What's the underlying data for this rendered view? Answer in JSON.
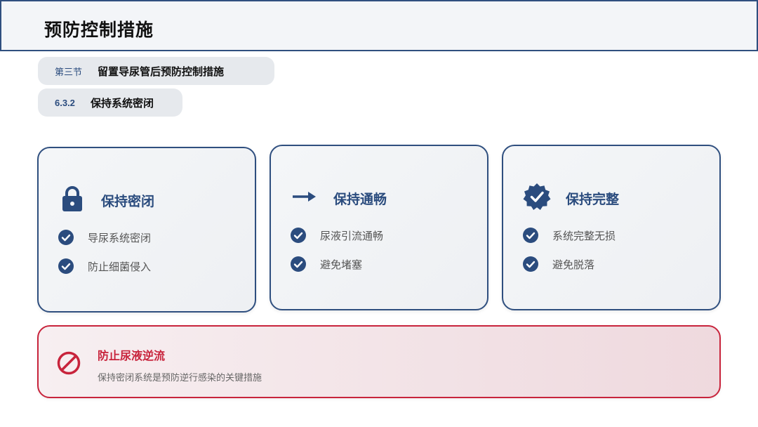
{
  "header": {
    "title": "预防控制措施"
  },
  "section": {
    "tag": "第三节",
    "title": "留置导尿管后预防控制措施"
  },
  "subsection": {
    "tag": "6.3.2",
    "title": "保持系统密闭"
  },
  "cards": [
    {
      "icon": "lock-icon",
      "title": "保持密闭",
      "items": [
        "导尿系统密闭",
        "防止细菌侵入"
      ]
    },
    {
      "icon": "arrow-right-icon",
      "title": "保持通畅",
      "items": [
        "尿液引流通畅",
        "避免堵塞"
      ]
    },
    {
      "icon": "verified-badge-icon",
      "title": "保持完整",
      "items": [
        "系统完整无损",
        "避免脱落"
      ]
    }
  ],
  "warning": {
    "icon": "prohibited-icon",
    "title": "防止尿液逆流",
    "description": "保持密闭系统是预防逆行感染的关键措施"
  },
  "colors": {
    "accent": "#2b4c7e",
    "danger": "#c8243c"
  }
}
